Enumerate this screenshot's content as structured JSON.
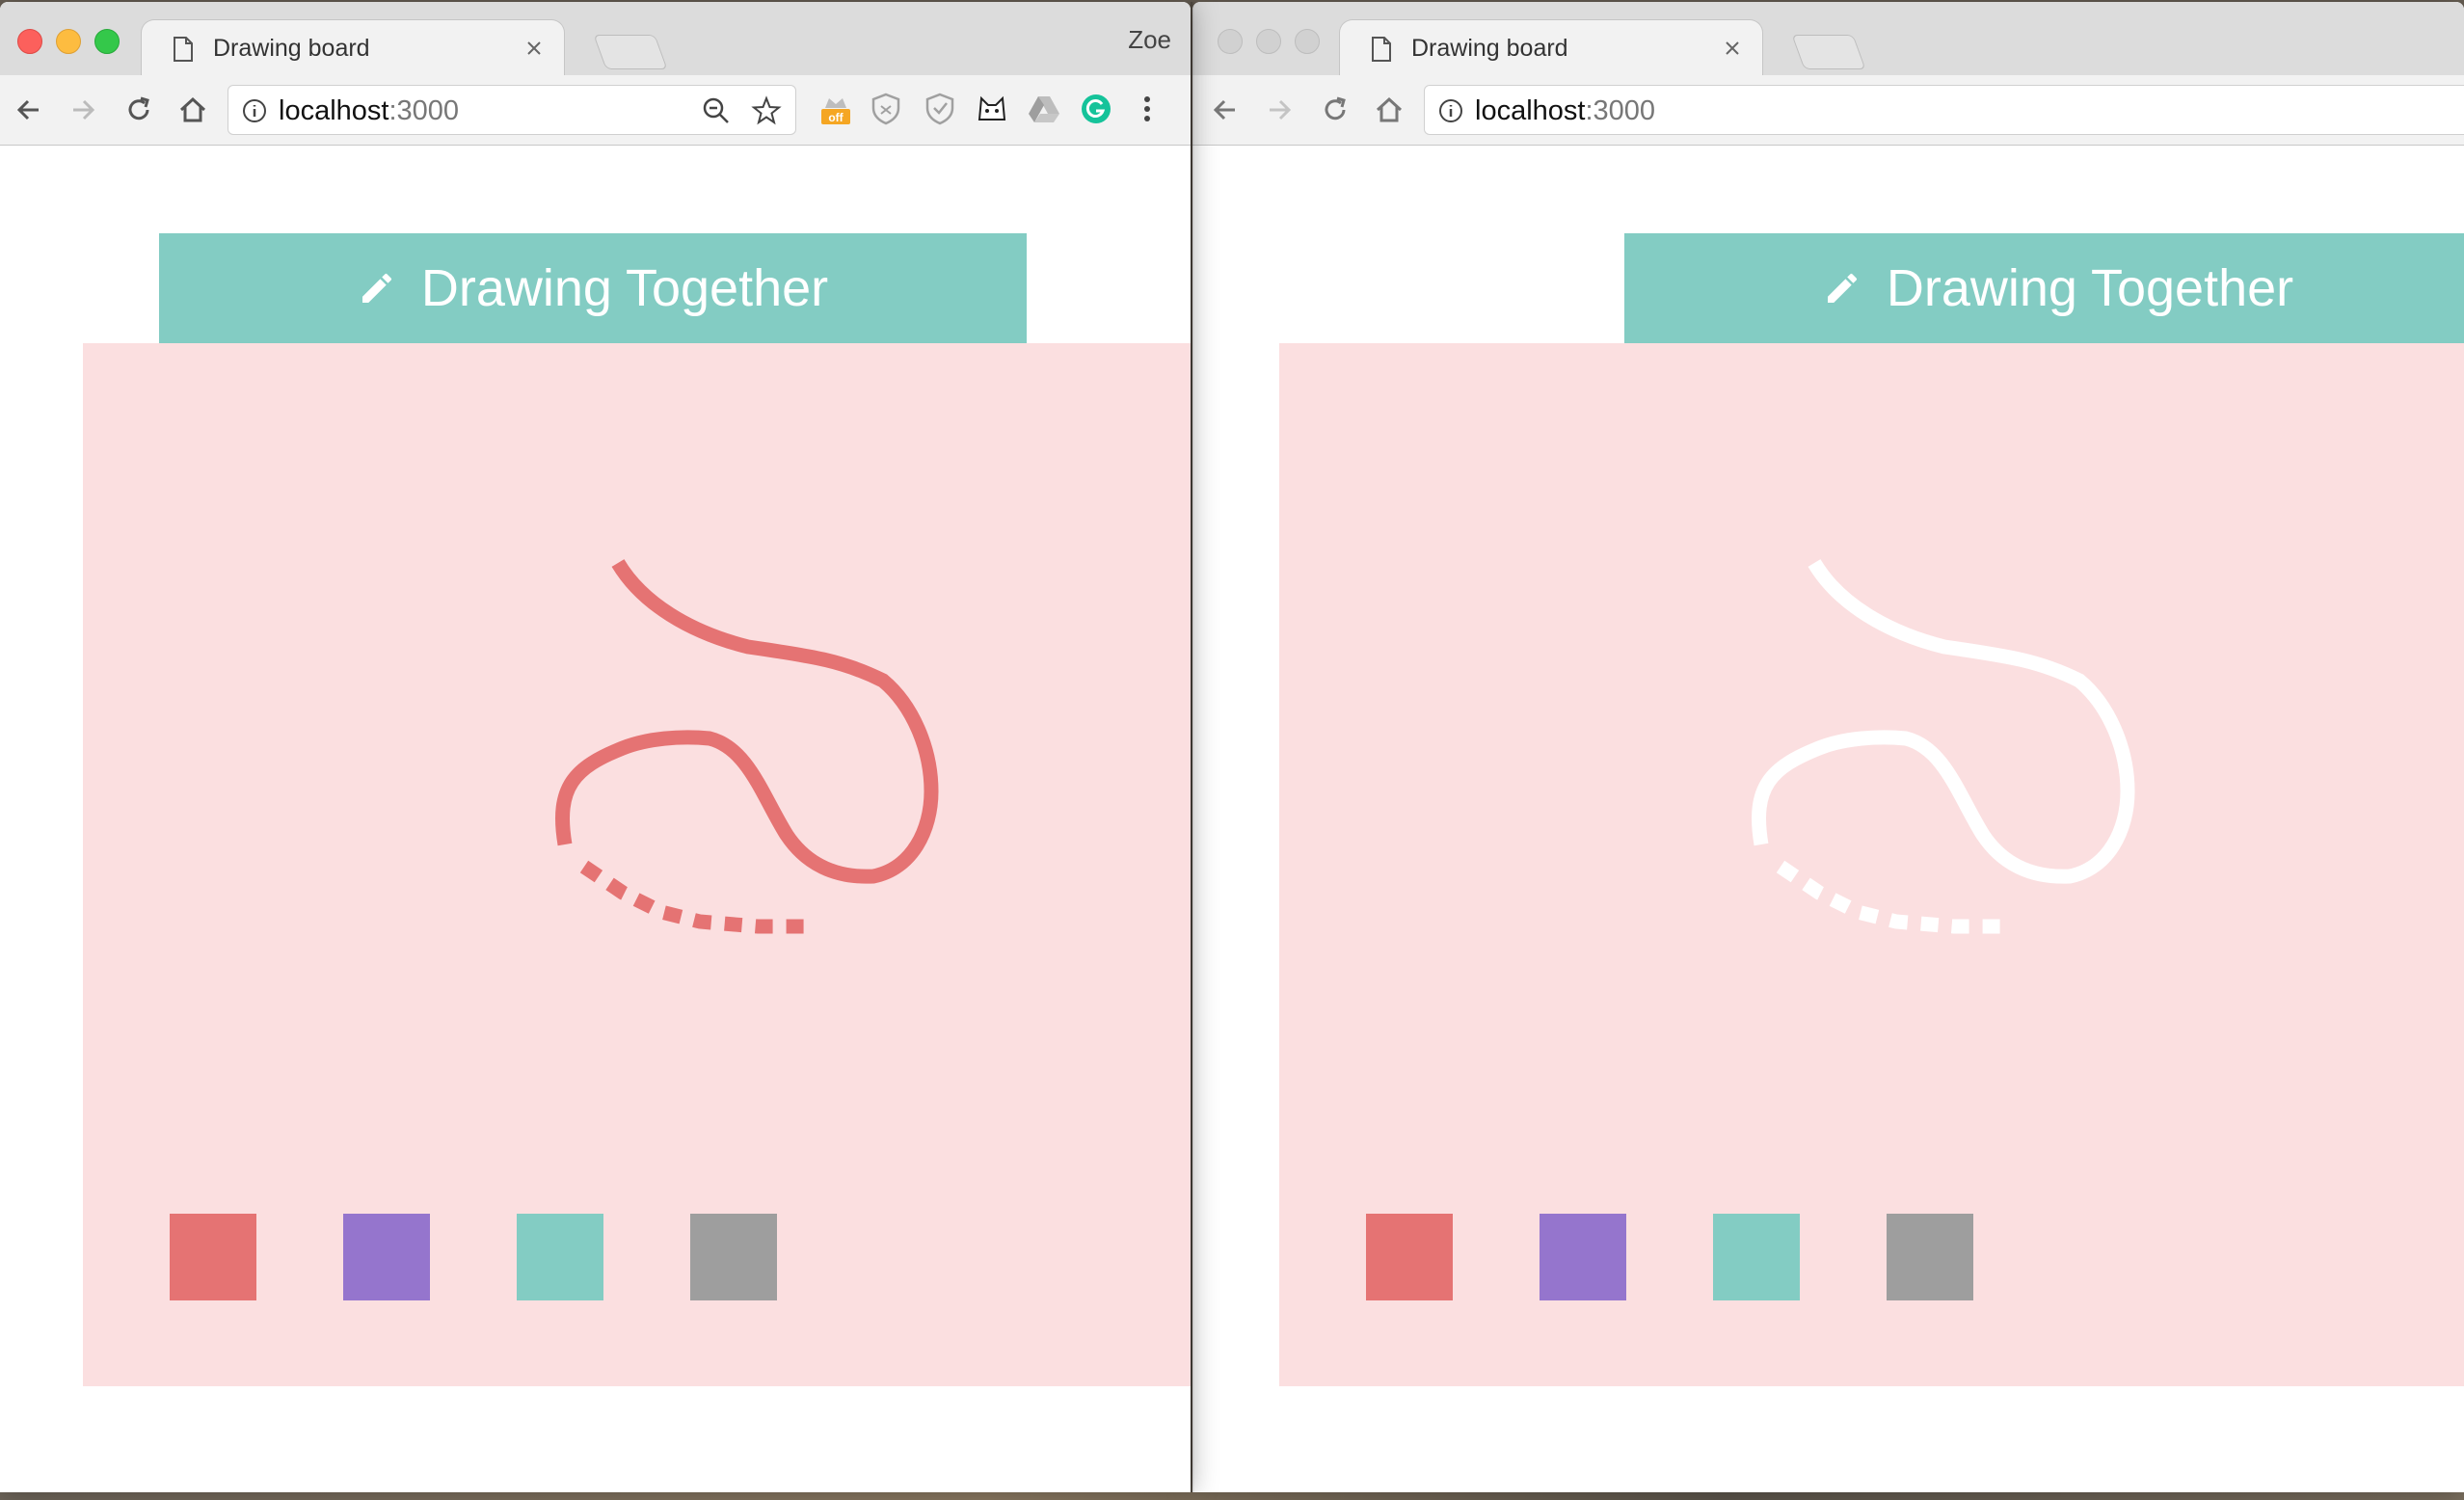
{
  "colors": {
    "header": "#83ccc3",
    "canvas_bg": "#fbdfe0",
    "stroke_left": "#e57373",
    "stroke_right": "#ffffff"
  },
  "windows": [
    {
      "tab_title": "Drawing board",
      "profile_name": "Zoe",
      "url_host": "localhost",
      "url_port": ":3000",
      "app_title": "Drawing Together",
      "extensions": [
        "zoom-out-icon",
        "bookmark-star-icon",
        "crown-off-extension-icon",
        "shield-extension-icon",
        "shield-check-extension-icon",
        "cat-extension-icon",
        "drive-extension-icon",
        "grammarly-extension-icon",
        "more-menu-icon"
      ],
      "swatches": [
        {
          "name": "red",
          "color": "#e57373"
        },
        {
          "name": "purple",
          "color": "#9575cd"
        },
        {
          "name": "teal",
          "color": "#83ccc3"
        },
        {
          "name": "gray",
          "color": "#9e9e9e"
        }
      ]
    },
    {
      "tab_title": "Drawing board",
      "url_host": "localhost",
      "url_port": ":3000",
      "app_title": "Drawing Together",
      "swatches": [
        {
          "name": "red",
          "color": "#e57373"
        },
        {
          "name": "purple",
          "color": "#9575cd"
        },
        {
          "name": "teal",
          "color": "#83ccc3"
        },
        {
          "name": "gray",
          "color": "#9e9e9e"
        }
      ]
    }
  ]
}
